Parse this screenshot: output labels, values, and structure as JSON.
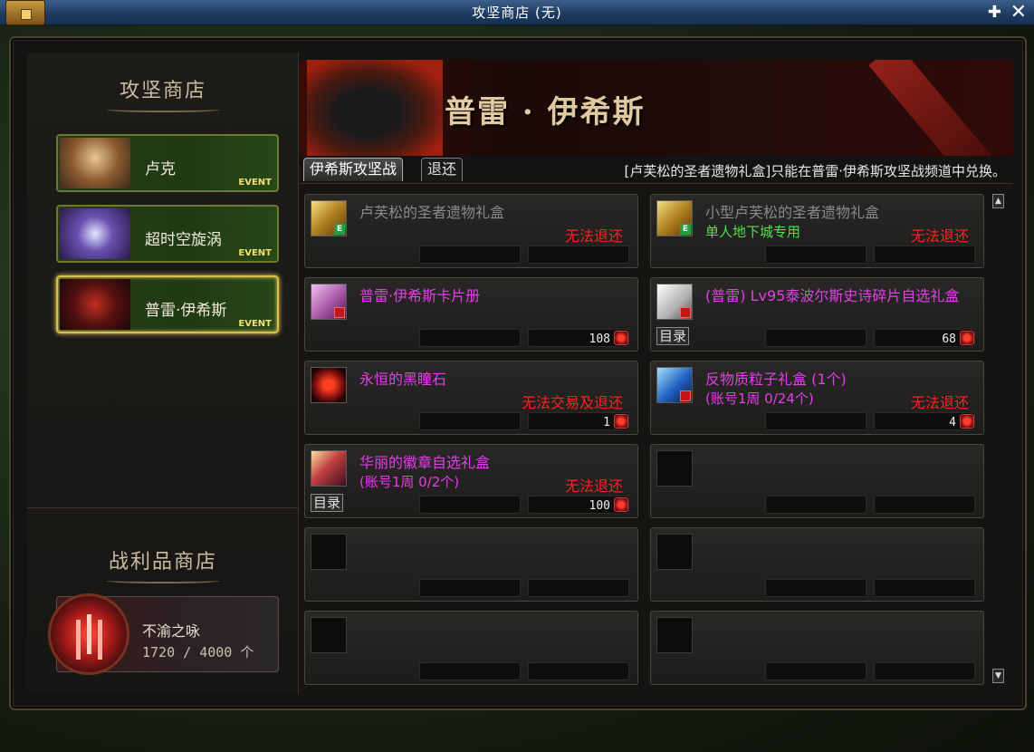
{
  "window": {
    "title": "攻坚商店 (无)"
  },
  "sidebar": {
    "shop_title": "攻坚商店",
    "shops": [
      {
        "name": "卢克",
        "badge": "EVENT"
      },
      {
        "name": "超时空旋涡",
        "badge": "EVENT"
      },
      {
        "name": "普雷·伊希斯",
        "badge": "EVENT"
      }
    ],
    "loot_title": "战利品商店",
    "currency": {
      "name": "不渝之咏",
      "count": "1720 / 4000 个"
    }
  },
  "banner": {
    "boss_name": "普雷 · 伊希斯"
  },
  "tabs": {
    "items": [
      "伊希斯攻坚战",
      "退还"
    ],
    "notice": "[卢芙松的圣者遗物礼盒]只能在普雷·伊希斯攻坚战频道中兑换。"
  },
  "items": [
    {
      "name": "卢芙松的圣者遗物礼盒",
      "sub": "",
      "note": "无法退还",
      "price": "",
      "catalog": ""
    },
    {
      "name": "小型卢芙松的圣者遗物礼盒",
      "sub": "单人地下城专用",
      "note": "无法退还",
      "price": "",
      "catalog": ""
    },
    {
      "name": "普雷·伊希斯卡片册",
      "sub": "",
      "note": "",
      "price": "108",
      "catalog": ""
    },
    {
      "name": "(普雷) Lv95泰波尔斯史诗碎片自选礼盒",
      "sub": "",
      "note": "",
      "price": "68",
      "catalog": "目录"
    },
    {
      "name": "永恒的黑瞳石",
      "sub": "",
      "note": "无法交易及退还",
      "price": "1",
      "catalog": ""
    },
    {
      "name": "反物质粒子礼盒 (1个)",
      "sub": "(账号1周 0/24个)",
      "note": "无法退还",
      "price": "4",
      "catalog": ""
    },
    {
      "name": "华丽的徽章自选礼盒",
      "sub": "(账号1周 0/2个)",
      "note": "无法退还",
      "price": "100",
      "catalog": "目录"
    }
  ]
}
